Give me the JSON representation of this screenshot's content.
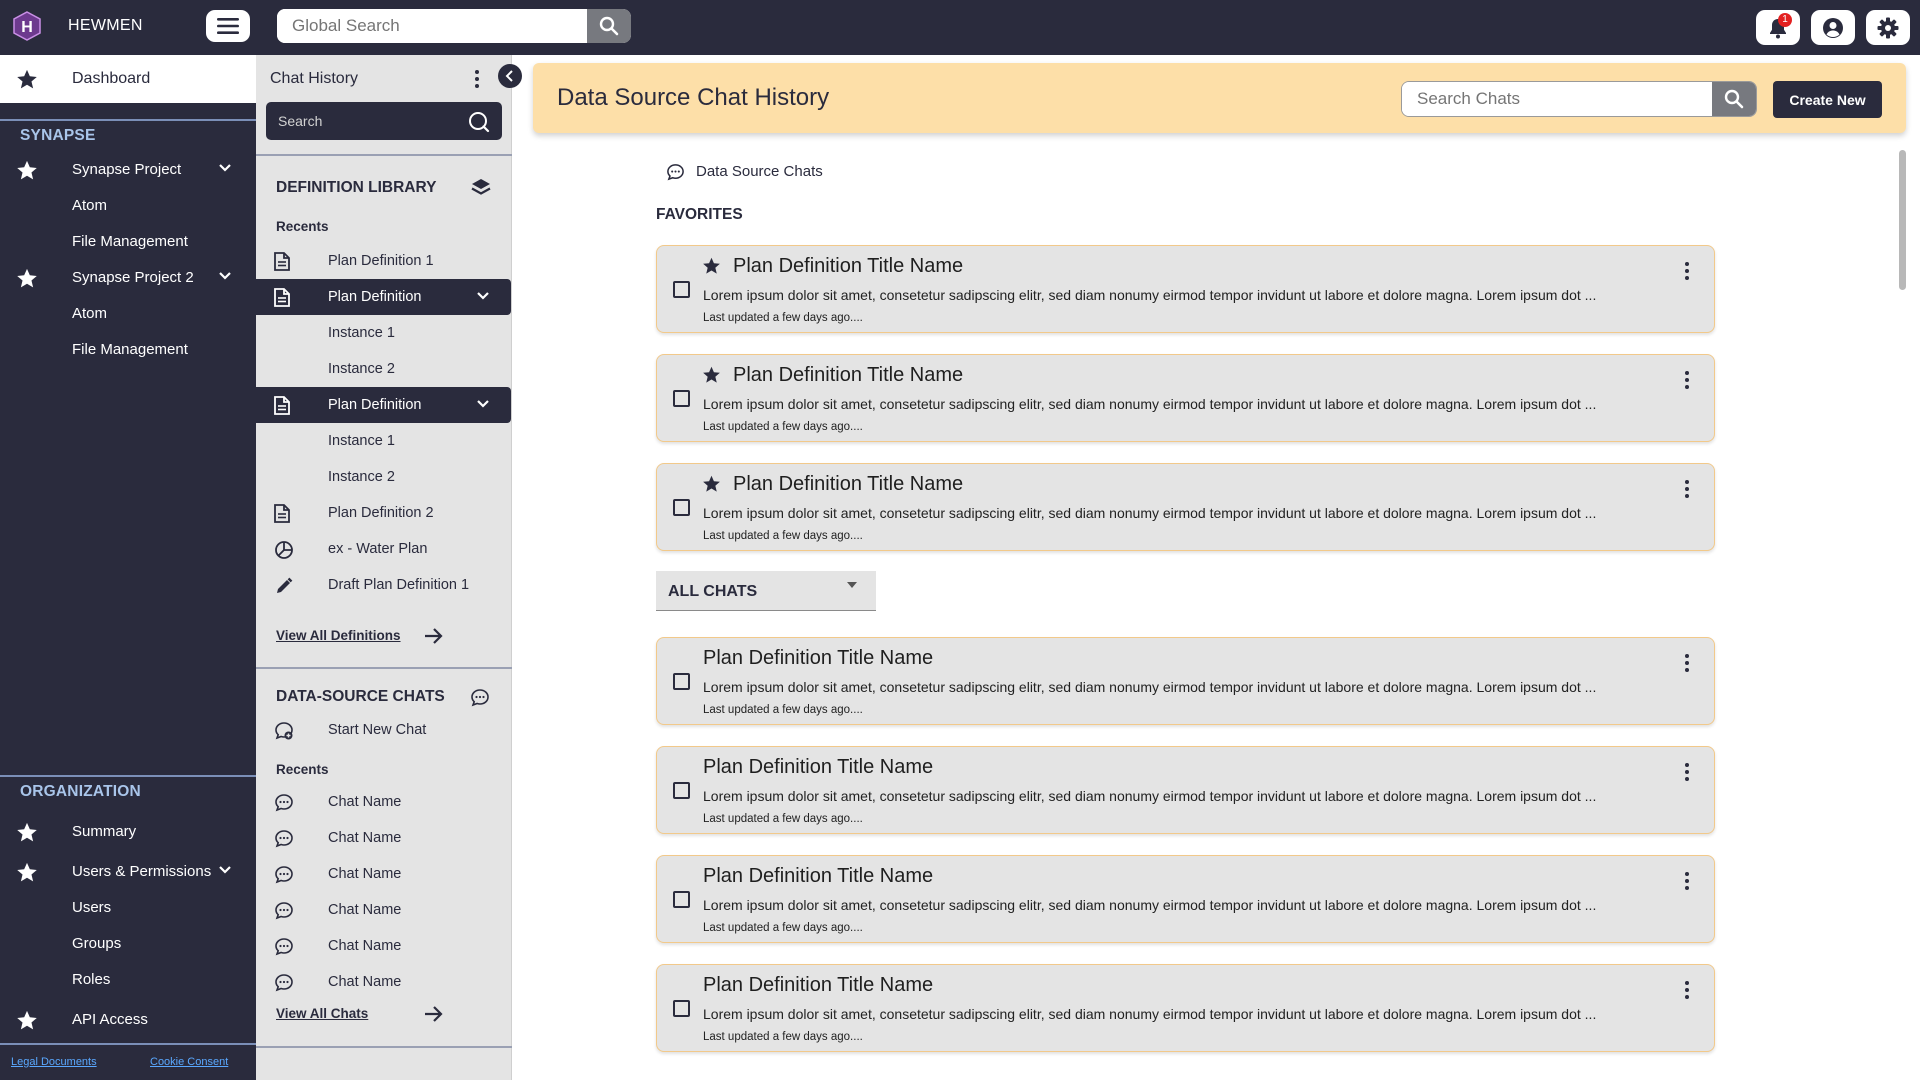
{
  "topbar": {
    "brand": "HEWMEN",
    "logo_letter": "H",
    "search_placeholder": "Global Search",
    "notification_count": "1"
  },
  "leftnav": {
    "dashboard": "Dashboard",
    "section_synapse": "SYNAPSE",
    "synapse_items": [
      {
        "label": "Synapse Project",
        "icon": "star-icon",
        "expandable": true
      },
      {
        "label": "Atom"
      },
      {
        "label": "File Management"
      },
      {
        "label": "Synapse Project 2",
        "icon": "star-icon",
        "expandable": true
      },
      {
        "label": "Atom"
      },
      {
        "label": "File Management"
      }
    ],
    "section_org": "ORGANIZATION",
    "org_items": [
      {
        "label": "Summary",
        "icon": "star-icon"
      },
      {
        "label": "Users & Permissions",
        "icon": "star-icon",
        "expandable": true
      },
      {
        "label": "Users"
      },
      {
        "label": "Groups"
      },
      {
        "label": "Roles"
      },
      {
        "label": "API Access",
        "icon": "star-icon"
      }
    ],
    "footer": {
      "legal": "Legal Documents",
      "cookie": "Cookie Consent"
    }
  },
  "midpanel": {
    "title": "Chat History",
    "search_placeholder": "Search",
    "def_library": {
      "heading": "DEFINITION LIBRARY",
      "recents_label": "Recents",
      "items": [
        {
          "label": "Plan Definition 1",
          "icon": "document-icon"
        },
        {
          "label": "Plan Definition",
          "icon": "document-icon",
          "active": true
        },
        {
          "label": "Instance 1"
        },
        {
          "label": "Instance 2"
        },
        {
          "label": "Plan Definition",
          "icon": "document-icon",
          "active": true
        },
        {
          "label": "Instance 1"
        },
        {
          "label": "Instance 2"
        },
        {
          "label": "Plan Definition 2",
          "icon": "document-icon"
        },
        {
          "label": "ex - Water Plan",
          "icon": "pie-chart-icon"
        },
        {
          "label": "Draft Plan Definition 1",
          "icon": "pencil-icon"
        }
      ],
      "view_all": "View All Definitions"
    },
    "ds_chats": {
      "heading": "DATA-SOURCE CHATS",
      "start_new": "Start New Chat",
      "recents_label": "Recents",
      "items": [
        "Chat Name",
        "Chat Name",
        "Chat Name",
        "Chat Name",
        "Chat Name",
        "Chat Name"
      ],
      "view_all": "View All Chats"
    }
  },
  "main": {
    "title": "Data Source Chat History",
    "search_placeholder": "Search Chats",
    "create_label": "Create New",
    "breadcrumb": "Data Source Chats",
    "favorites_label": "FAVORITES",
    "favorites": [
      {
        "title": "Plan Definition Title Name",
        "desc": "Lorem ipsum dolor sit amet, consetetur sadipscing elitr, sed diam nonumy eirmod tempor invidunt ut labore et dolore magna. Lorem ipsum dot ...",
        "updated": "Last updated a few days ago....",
        "starred": true
      },
      {
        "title": "Plan Definition Title Name",
        "desc": "Lorem ipsum dolor sit amet, consetetur sadipscing elitr, sed diam nonumy eirmod tempor invidunt ut labore et dolore magna. Lorem ipsum dot ...",
        "updated": "Last updated a few days ago....",
        "starred": true
      },
      {
        "title": "Plan Definition Title Name",
        "desc": "Lorem ipsum dolor sit amet, consetetur sadipscing elitr, sed diam nonumy eirmod tempor invidunt ut labore et dolore magna. Lorem ipsum dot ...",
        "updated": "Last updated a few days ago....",
        "starred": true
      }
    ],
    "all_chats_label": "ALL CHATS",
    "all_chats": [
      {
        "title": "Plan Definition Title Name",
        "desc": "Lorem ipsum dolor sit amet, consetetur sadipscing elitr, sed diam nonumy eirmod tempor invidunt ut labore et dolore magna. Lorem ipsum dot ...",
        "updated": "Last updated a few days ago...."
      },
      {
        "title": "Plan Definition Title Name",
        "desc": "Lorem ipsum dolor sit amet, consetetur sadipscing elitr, sed diam nonumy eirmod tempor invidunt ut labore et dolore magna. Lorem ipsum dot ...",
        "updated": "Last updated a few days ago...."
      },
      {
        "title": "Plan Definition Title Name",
        "desc": "Lorem ipsum dolor sit amet, consetetur sadipscing elitr, sed diam nonumy eirmod tempor invidunt ut labore et dolore magna. Lorem ipsum dot ...",
        "updated": "Last updated a few days ago...."
      },
      {
        "title": "Plan Definition Title Name",
        "desc": "Lorem ipsum dolor sit amet, consetetur sadipscing elitr, sed diam nonumy eirmod tempor invidunt ut labore et dolore magna. Lorem ipsum dot ...",
        "updated": "Last updated a few days ago...."
      }
    ]
  },
  "colors": {
    "navy": "#2a2b3d",
    "header_accent": "#fddfa8",
    "card_border": "#f2c98a",
    "panel_grey": "#e4e4e4",
    "section_blue": "#a9c5ea",
    "badge_red": "#e32020"
  }
}
